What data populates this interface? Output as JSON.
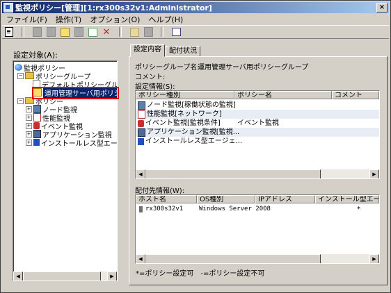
{
  "window": {
    "title": "監視ポリシー[管理][1:rx300s32v1:Administrator]",
    "close": "×"
  },
  "menu": [
    "ファイル(F)",
    "操作(T)",
    "オプション(O)",
    "ヘルプ(H)"
  ],
  "left": {
    "label": "設定対象(A):",
    "tree": [
      {
        "text": "監視ポリシー",
        "icon": "globe-icon",
        "toggle": ""
      },
      {
        "text": "ポリシーグループ",
        "icon": "folder-icon",
        "toggle": "−"
      },
      {
        "text": "デフォルトポリシーグループ",
        "icon": "policy-doc-icon",
        "toggle": ""
      },
      {
        "text": "運用管理サーバ用ポリシー",
        "icon": "policy-group-icon",
        "toggle": ""
      },
      {
        "text": "ポリシー",
        "icon": "folder-icon",
        "toggle": "−"
      },
      {
        "text": "ノード監視",
        "icon": "node-icon",
        "toggle": "+"
      },
      {
        "text": "性能監視",
        "icon": "performance-icon",
        "toggle": "+"
      },
      {
        "text": "イベント監視",
        "icon": "event-icon",
        "toggle": "+"
      },
      {
        "text": "アプリケーション監視",
        "icon": "application-icon",
        "toggle": "+"
      },
      {
        "text": "インストールレス型エージ",
        "icon": "installless-icon",
        "toggle": "+"
      }
    ]
  },
  "tabs": [
    "設定内容",
    "配付状況"
  ],
  "details": {
    "group_name_label": "ポリシーグループ名:",
    "group_name_value": "運用管理サーバ用ポリシーグループ",
    "comment_label": "コメント:",
    "policy_info_label": "設定情報(S):",
    "policy_headers": [
      "ポリシー種別",
      "ポリシー名",
      "コメント"
    ],
    "policies": [
      {
        "type": "ノード監視[稼働状態の監視]",
        "name": "",
        "icon": "node-icon"
      },
      {
        "type": "性能監視[ネットワーク]",
        "name": "",
        "icon": "performance-icon"
      },
      {
        "type": "イベント監視[監視条件]",
        "name": "イベント監視",
        "icon": "event-icon"
      },
      {
        "type": "アプリケーション監視[監視...",
        "name": "",
        "icon": "application-icon"
      },
      {
        "type": "インストールレス型エージェ...",
        "name": "",
        "icon": "installless-icon"
      }
    ],
    "dest_label": "配付先情報(W):",
    "dest_headers": [
      "ホスト名",
      "OS種別",
      "IPアドレス",
      "インストール型エージェ"
    ],
    "destinations": [
      {
        "host": "rx300s32v1",
        "os": "Windows Server 2008",
        "ip": "",
        "agent": "*"
      }
    ],
    "legend": "*=ポリシー設定可　-=ポリシー設定不可"
  }
}
